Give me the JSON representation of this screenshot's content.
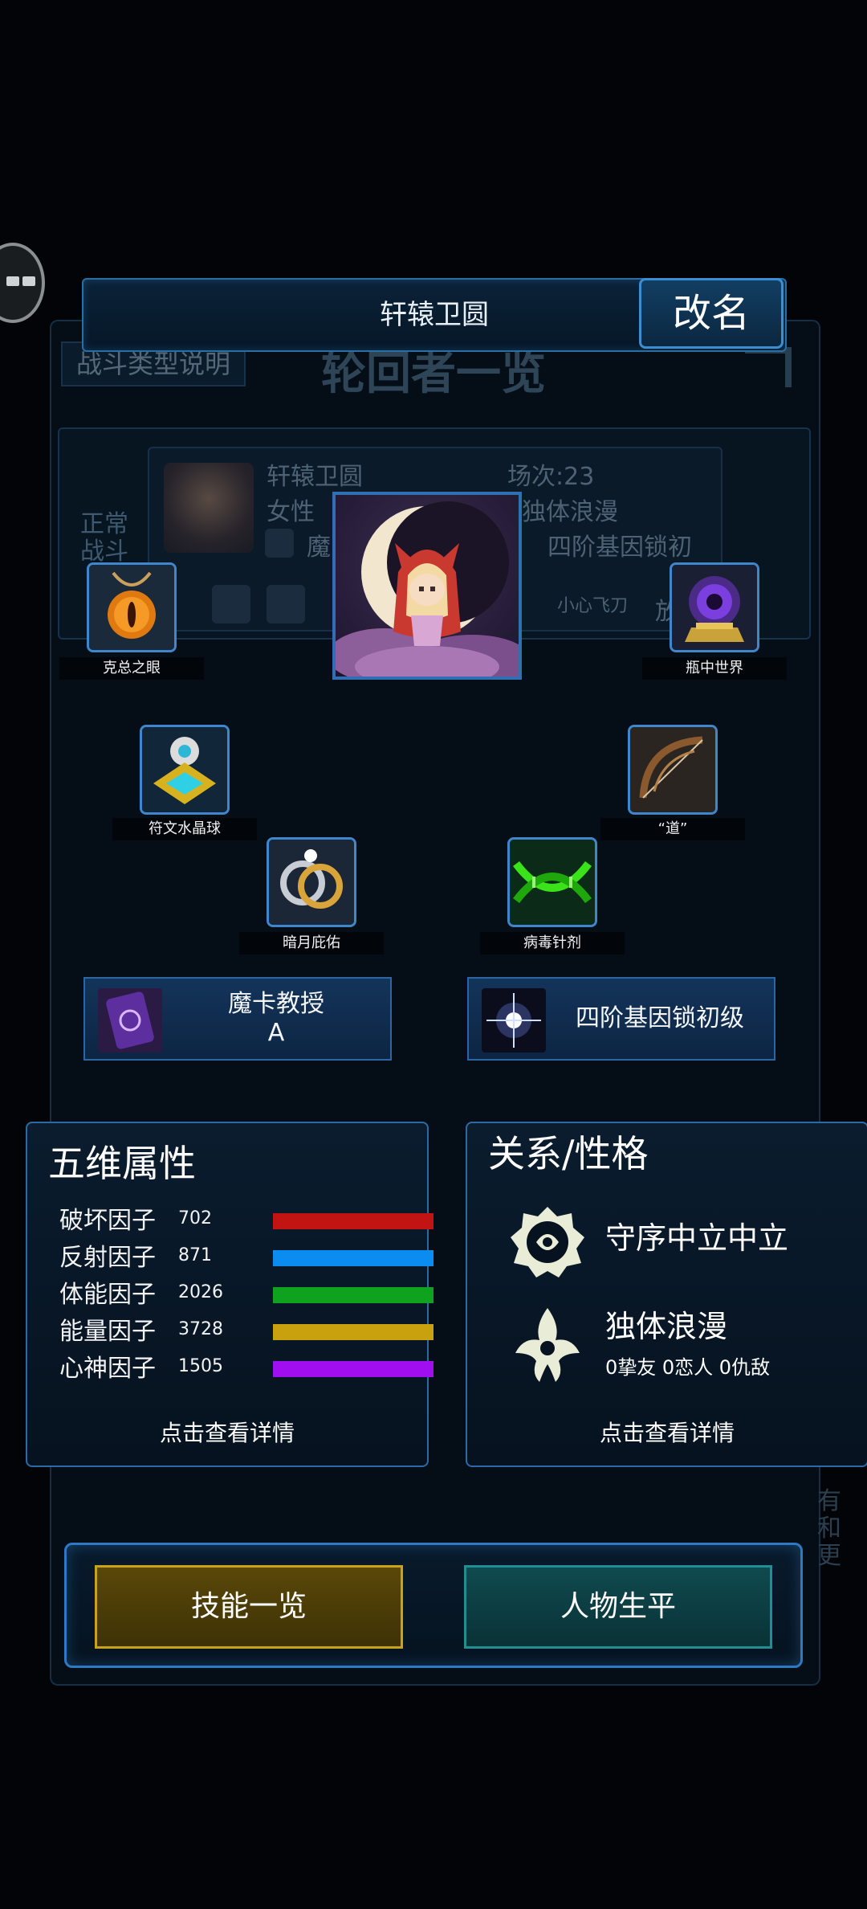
{
  "background": {
    "tab_explain": "战斗类型说明",
    "title": "轮回者一览",
    "status": "正常战斗",
    "card": {
      "name": "轩辕卫圆",
      "gender": "女性",
      "talent_short": "魔",
      "rounds": "场次:23",
      "trait": "独体浪漫",
      "gene": "四阶基因锁初",
      "skill": "小心飞刀",
      "button": "放"
    },
    "side_text": "有和更"
  },
  "name_bar": {
    "name": "轩辕卫圆",
    "rename_label": "改名"
  },
  "equipment": [
    {
      "label": "克总之眼",
      "icon": "amulet-icon"
    },
    {
      "label": "瓶中世界",
      "icon": "crystal-ball-icon"
    },
    {
      "label": "符文水晶球",
      "icon": "rune-crystal-icon"
    },
    {
      "label": "“道”",
      "icon": "bow-icon"
    },
    {
      "label": "暗月庇佑",
      "icon": "rings-icon"
    },
    {
      "label": "病毒针剂",
      "icon": "dna-icon"
    }
  ],
  "talents": [
    {
      "title": "魔卡教授",
      "grade": "A",
      "icon": "magic-card-icon"
    },
    {
      "title": "四阶基因锁初级",
      "grade": "",
      "icon": "starburst-icon"
    }
  ],
  "attributes": {
    "title": "五维属性",
    "footer": "点击查看详情",
    "items": [
      {
        "name": "破坏因子",
        "value": "702",
        "color": "#c31414",
        "fill": 1.0
      },
      {
        "name": "反射因子",
        "value": "871",
        "color": "#0a8cf0",
        "fill": 1.0
      },
      {
        "name": "体能因子",
        "value": "2026",
        "color": "#0ea21e",
        "fill": 1.0
      },
      {
        "name": "能量因子",
        "value": "3728",
        "color": "#c9a00e",
        "fill": 1.0
      },
      {
        "name": "心神因子",
        "value": "1505",
        "color": "#a10ff0",
        "fill": 1.0
      }
    ]
  },
  "relations": {
    "title": "关系/性格",
    "alignment": "守序中立中立",
    "personality": "独体浪漫",
    "counts": "0挚友 0恋人 0仇敌",
    "footer": "点击查看详情"
  },
  "buttons": {
    "skills": "技能一览",
    "life": "人物生平"
  }
}
